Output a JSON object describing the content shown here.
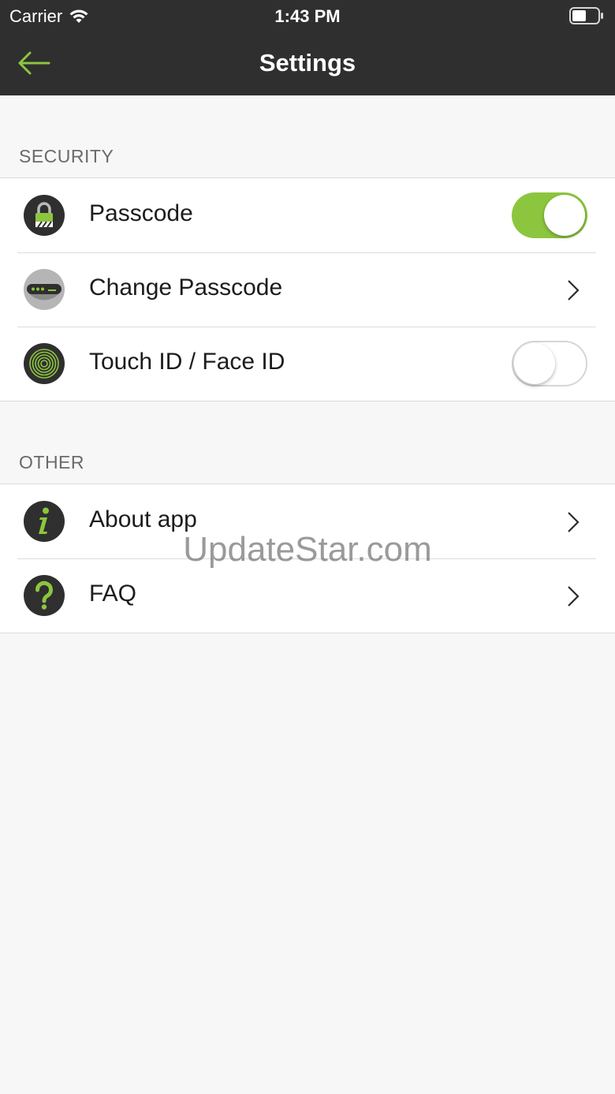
{
  "status_bar": {
    "carrier": "Carrier",
    "time": "1:43 PM"
  },
  "nav": {
    "title": "Settings",
    "back_icon": "arrow-left-icon"
  },
  "colors": {
    "accent": "#8cc63e",
    "bar": "#2f2f2f"
  },
  "sections": [
    {
      "header": "SECURITY",
      "items": [
        {
          "label": "Passcode",
          "icon": "lock-icon",
          "control": "toggle",
          "on": true
        },
        {
          "label": "Change Passcode",
          "icon": "passcode-field-icon",
          "control": "chevron"
        },
        {
          "label": "Touch ID / Face ID",
          "icon": "fingerprint-icon",
          "control": "toggle",
          "on": false
        }
      ]
    },
    {
      "header": "OTHER",
      "items": [
        {
          "label": "About app",
          "icon": "info-icon",
          "control": "chevron"
        },
        {
          "label": "FAQ",
          "icon": "question-icon",
          "control": "chevron"
        }
      ]
    }
  ],
  "watermark": "UpdateStar.com"
}
